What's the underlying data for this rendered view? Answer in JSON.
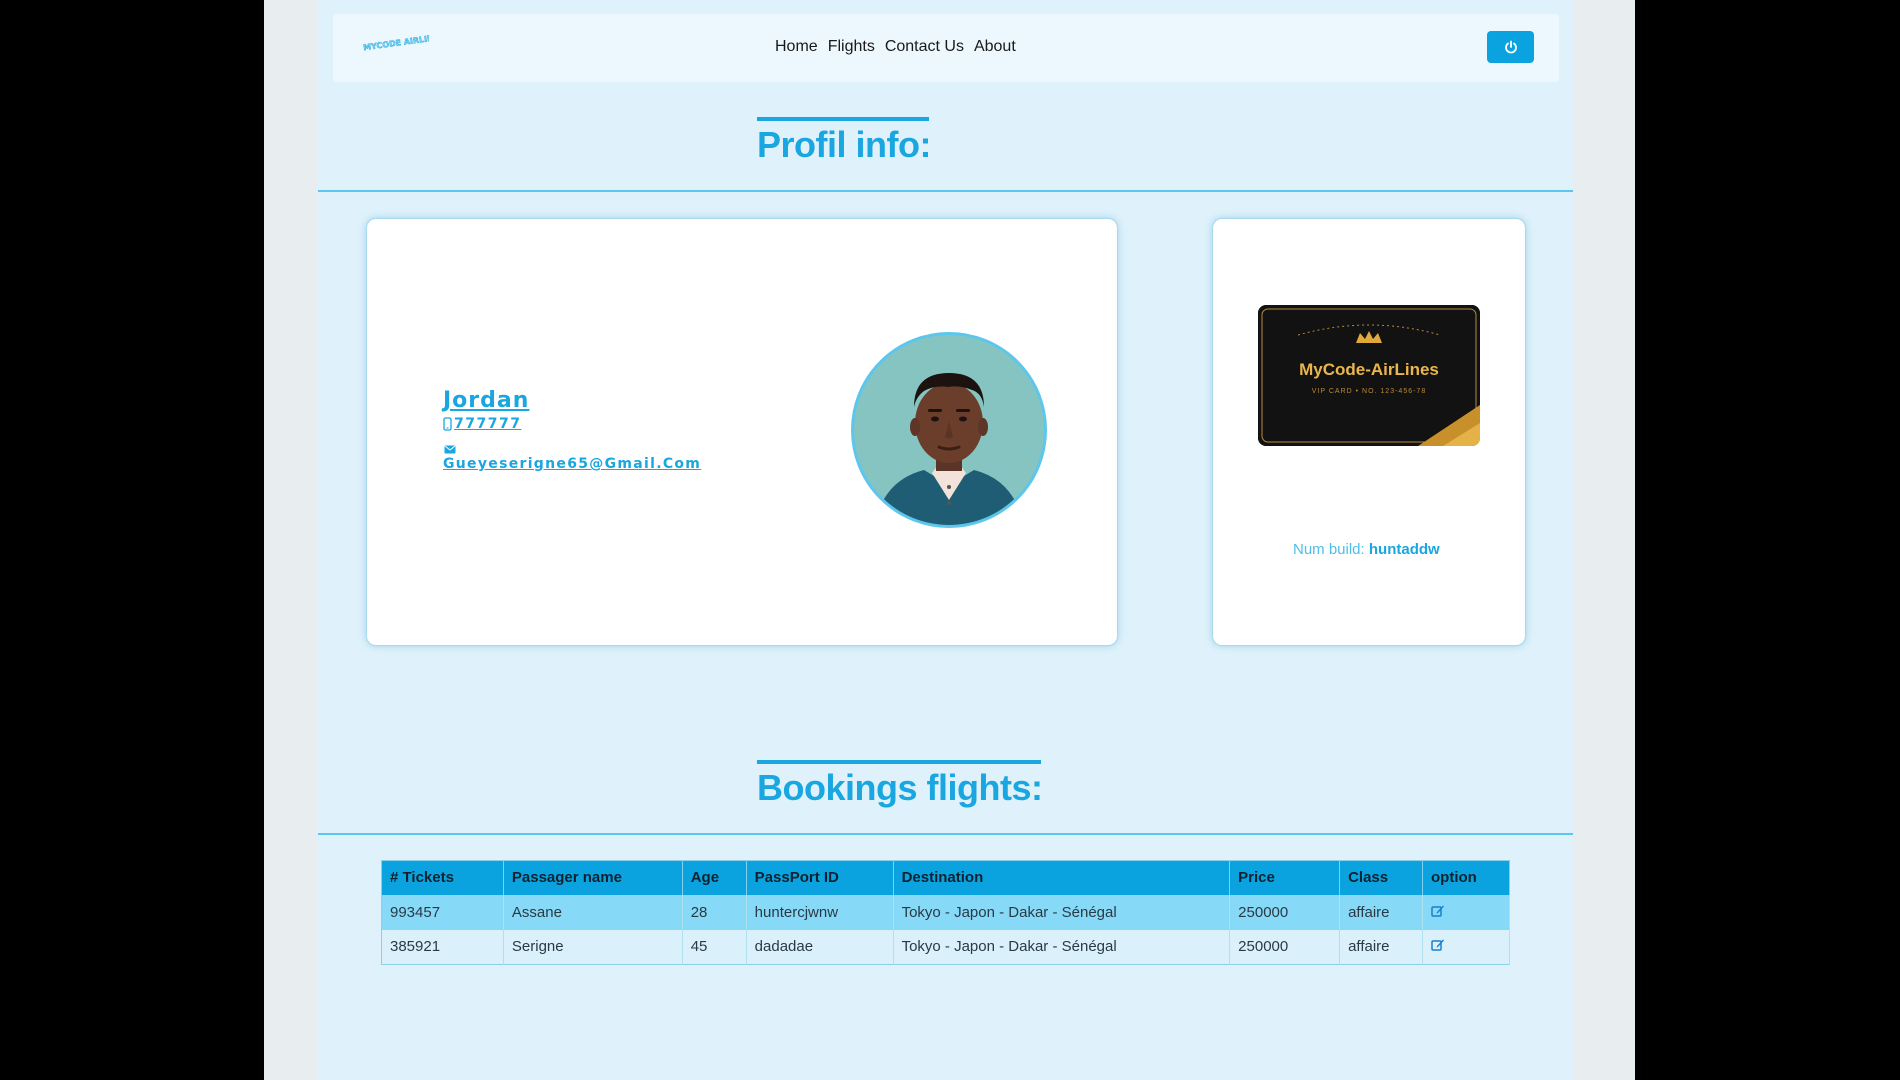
{
  "nav": {
    "logo_text": "MYCODE AIRLINES",
    "links": [
      "Home",
      "Flights",
      "Contact Us",
      "About"
    ],
    "power_icon": "power-icon"
  },
  "profile": {
    "title": "Profil info:",
    "name": "Jordan",
    "phone": "777777",
    "email": "Gueyeserigne65@Gmail.Com",
    "phone_icon": "phone-icon",
    "email_icon": "envelope-icon"
  },
  "vip": {
    "brand": "MyCode-AirLines",
    "card_line": "VIP CARD • NO. 123-456-78",
    "num_build_label": "Num build:",
    "num_build_value": "huntaddw"
  },
  "bookings": {
    "title": "Bookings flights:",
    "headers": [
      "# Tickets",
      "Passager name",
      "Age",
      "PassPort ID",
      "Destination",
      "Price",
      "Class",
      "option"
    ],
    "rows": [
      [
        "993457",
        "Assane",
        "28",
        "huntercjwnw",
        "Tokyo - Japon - Dakar - Sénégal",
        "250000",
        "affaire"
      ],
      [
        "385921",
        "Serigne",
        "45",
        "dadadae",
        "Tokyo - Japon - Dakar - Sénégal",
        "250000",
        "affaire"
      ]
    ],
    "edit_icon": "edit-icon"
  },
  "colors": {
    "accent": "#1aa6e0",
    "button": "#0aa3e0",
    "page_bg": "#dff2fb",
    "row_highlight": "#87d9f8"
  }
}
